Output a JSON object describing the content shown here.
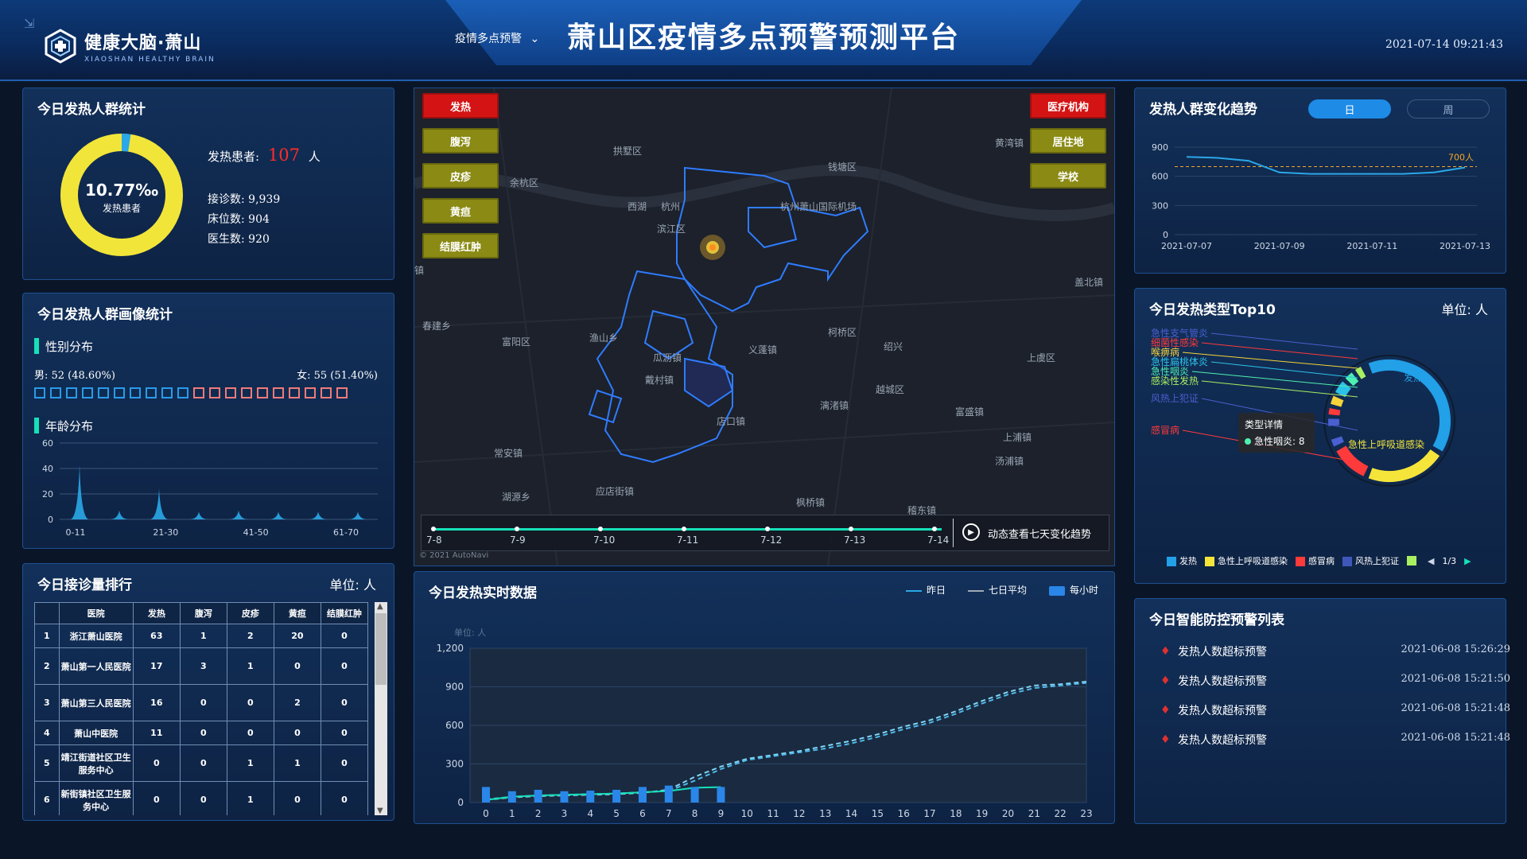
{
  "header": {
    "logo_title": "健康大脑·萧山",
    "logo_sub": "XIAOSHAN HEALTHY BRAIN",
    "nav_label": "疫情多点预警",
    "title": "萧山区疫情多点预警预测平台",
    "datetime": "2021-07-14 09:21:43"
  },
  "fever_stats": {
    "title": "今日发热人群统计",
    "percent": "10.77‰",
    "percent_label": "发热患者",
    "ratio": 0.01077,
    "patients_label": "发热患者:",
    "patients_value": "107",
    "patients_unit": "人",
    "visits": "接诊数: 9,939",
    "beds": "床位数: 904",
    "doctors": "医生数: 920"
  },
  "profile": {
    "title": "今日发热人群画像统计",
    "gender_title": "性别分布",
    "male": "男: 52 (48.60%)",
    "female": "女: 55 (51.40%)",
    "male_boxes": 10,
    "female_boxes": 10,
    "age_title": "年龄分布",
    "age_chart": {
      "type": "area",
      "yticks": [
        "60",
        "40",
        "20",
        "0"
      ],
      "ylim": [
        0,
        60
      ],
      "xticks": [
        "0-11",
        "21-30",
        "41-50",
        "61-70"
      ],
      "values": [
        0,
        43,
        0,
        7,
        0,
        24,
        0,
        6,
        0,
        7,
        0,
        6,
        0,
        6,
        0,
        6,
        0
      ]
    }
  },
  "ranking": {
    "title": "今日接诊量排行",
    "unit": "单位: 人",
    "columns": [
      "",
      "医院",
      "发热",
      "腹泻",
      "皮疹",
      "黄疸",
      "结膜红肿"
    ],
    "rows": [
      [
        "1",
        "浙江萧山医院",
        "63",
        "1",
        "2",
        "20",
        "0"
      ],
      [
        "2",
        "萧山第一人民医院",
        "17",
        "3",
        "1",
        "0",
        "0"
      ],
      [
        "3",
        "萧山第三人民医院",
        "16",
        "0",
        "0",
        "2",
        "0"
      ],
      [
        "4",
        "萧山中医院",
        "11",
        "0",
        "0",
        "0",
        "0"
      ],
      [
        "5",
        "靖江街道社区卫生服务中心",
        "0",
        "0",
        "1",
        "1",
        "0"
      ],
      [
        "6",
        "新街镇社区卫生服务中心",
        "0",
        "0",
        "1",
        "0",
        "0"
      ]
    ]
  },
  "map": {
    "left_buttons": [
      "发热",
      "腹泻",
      "皮疹",
      "黄疸",
      "结膜红肿"
    ],
    "right_buttons": [
      "医疗机构",
      "居住地",
      "学校"
    ],
    "labels": [
      "拱墅区",
      "钱塘区",
      "余杭区",
      "西湖",
      "杭州",
      "杭州萧山国际机场",
      "滨江区",
      "盖北镇",
      "春建乡",
      "富阳区",
      "渔山乡",
      "义蓬镇",
      "瓜沥镇",
      "柯桥区",
      "绍兴",
      "上虞区",
      "戴村镇",
      "越城区",
      "漓渚镇",
      "富盛镇",
      "店口镇",
      "常安镇",
      "汤浦镇",
      "上浦镇",
      "湖源乡",
      "应店街镇",
      "枫桥镇",
      "稽东镇",
      "黄湾镇",
      "镇"
    ],
    "timeline_dates": [
      "7-8",
      "7-9",
      "7-10",
      "7-11",
      "7-12",
      "7-13",
      "7-14"
    ],
    "trend_label": "动态查看七天变化趋势",
    "copyright": "© 2021 AutoNavi"
  },
  "realtime": {
    "title": "今日发热实时数据",
    "legend": [
      "昨日",
      "七日平均",
      "每小时"
    ],
    "unit": "单位: 人",
    "chart_data": {
      "type": "line",
      "x": [
        "0",
        "1",
        "2",
        "3",
        "4",
        "5",
        "6",
        "7",
        "8",
        "9",
        "10",
        "11",
        "12",
        "13",
        "14",
        "15",
        "16",
        "17",
        "18",
        "19",
        "20",
        "21",
        "22",
        "23"
      ],
      "ylim": [
        0,
        1200
      ],
      "yticks": [
        "1,200",
        "900",
        "600",
        "300",
        "0"
      ],
      "series": [
        {
          "name": "昨日",
          "values": [
            20,
            40,
            50,
            55,
            60,
            65,
            75,
            100,
            200,
            280,
            340,
            370,
            400,
            440,
            480,
            530,
            590,
            640,
            710,
            790,
            860,
            910,
            920,
            940
          ]
        },
        {
          "name": "七日平均",
          "values": [
            25,
            45,
            55,
            60,
            65,
            70,
            80,
            90,
            170,
            260,
            330,
            360,
            390,
            420,
            460,
            510,
            570,
            620,
            690,
            770,
            840,
            890,
            910,
            930
          ]
        },
        {
          "name": "今日",
          "values": [
            20,
            45,
            55,
            60,
            65,
            70,
            80,
            90,
            115,
            120
          ]
        },
        {
          "name": "每小时",
          "values": [
            55,
            40,
            45,
            40,
            42,
            45,
            55,
            60,
            55,
            55
          ]
        }
      ]
    }
  },
  "trend": {
    "title": "发热人群变化趋势",
    "tab_day": "日",
    "tab_week": "周",
    "threshold_label": "700人",
    "chart_data": {
      "type": "line",
      "xticks": [
        "2021-07-07",
        "2021-07-09",
        "2021-07-11",
        "2021-07-13"
      ],
      "yticks": [
        "900",
        "600",
        "300",
        "0"
      ],
      "ylim": [
        0,
        900
      ],
      "threshold": 700,
      "values": [
        800,
        790,
        760,
        640,
        625,
        625,
        625,
        625,
        640,
        690
      ]
    }
  },
  "top10": {
    "title": "今日发热类型Top10",
    "unit": "单位: 人",
    "items": [
      {
        "name": "急性支气管炎",
        "color": "#4a5fd0"
      },
      {
        "name": "细菌性感染",
        "color": "#ff3a3a"
      },
      {
        "name": "喉痹病",
        "color": "#f5d33a"
      },
      {
        "name": "急性扁桃体炎",
        "color": "#2cc3e8"
      },
      {
        "name": "急性咽炎",
        "color": "#4ef0b0"
      },
      {
        "name": "感染性发热",
        "color": "#a8f060"
      },
      {
        "name": "风热上犯证",
        "color": "#4a5fd0"
      },
      {
        "name": "感冒病",
        "color": "#ff3a3a"
      },
      {
        "name": "急性上呼吸道感染",
        "color": "#f5e53a"
      },
      {
        "name": "发热",
        "color": "#22a0e8"
      }
    ],
    "tooltip_title": "类型详情",
    "tooltip_value": "急性咽炎: 8",
    "legend": [
      {
        "name": "发热",
        "color": "#22a0e8"
      },
      {
        "name": "急性上呼吸道感染",
        "color": "#f5e53a"
      },
      {
        "name": "感冒病",
        "color": "#ff3a3a"
      },
      {
        "name": "风热上犯证",
        "color": "#3f57b8"
      }
    ],
    "page": "1/3"
  },
  "alarms": {
    "title": "今日智能防控预警列表",
    "rows": [
      {
        "name": "发热人数超标预警",
        "time": "2021-06-08 15:26:29"
      },
      {
        "name": "发热人数超标预警",
        "time": "2021-06-08 15:21:50"
      },
      {
        "name": "发热人数超标预警",
        "time": "2021-06-08 15:21:48"
      },
      {
        "name": "发热人数超标预警",
        "time": "2021-06-08 15:21:48"
      }
    ]
  }
}
